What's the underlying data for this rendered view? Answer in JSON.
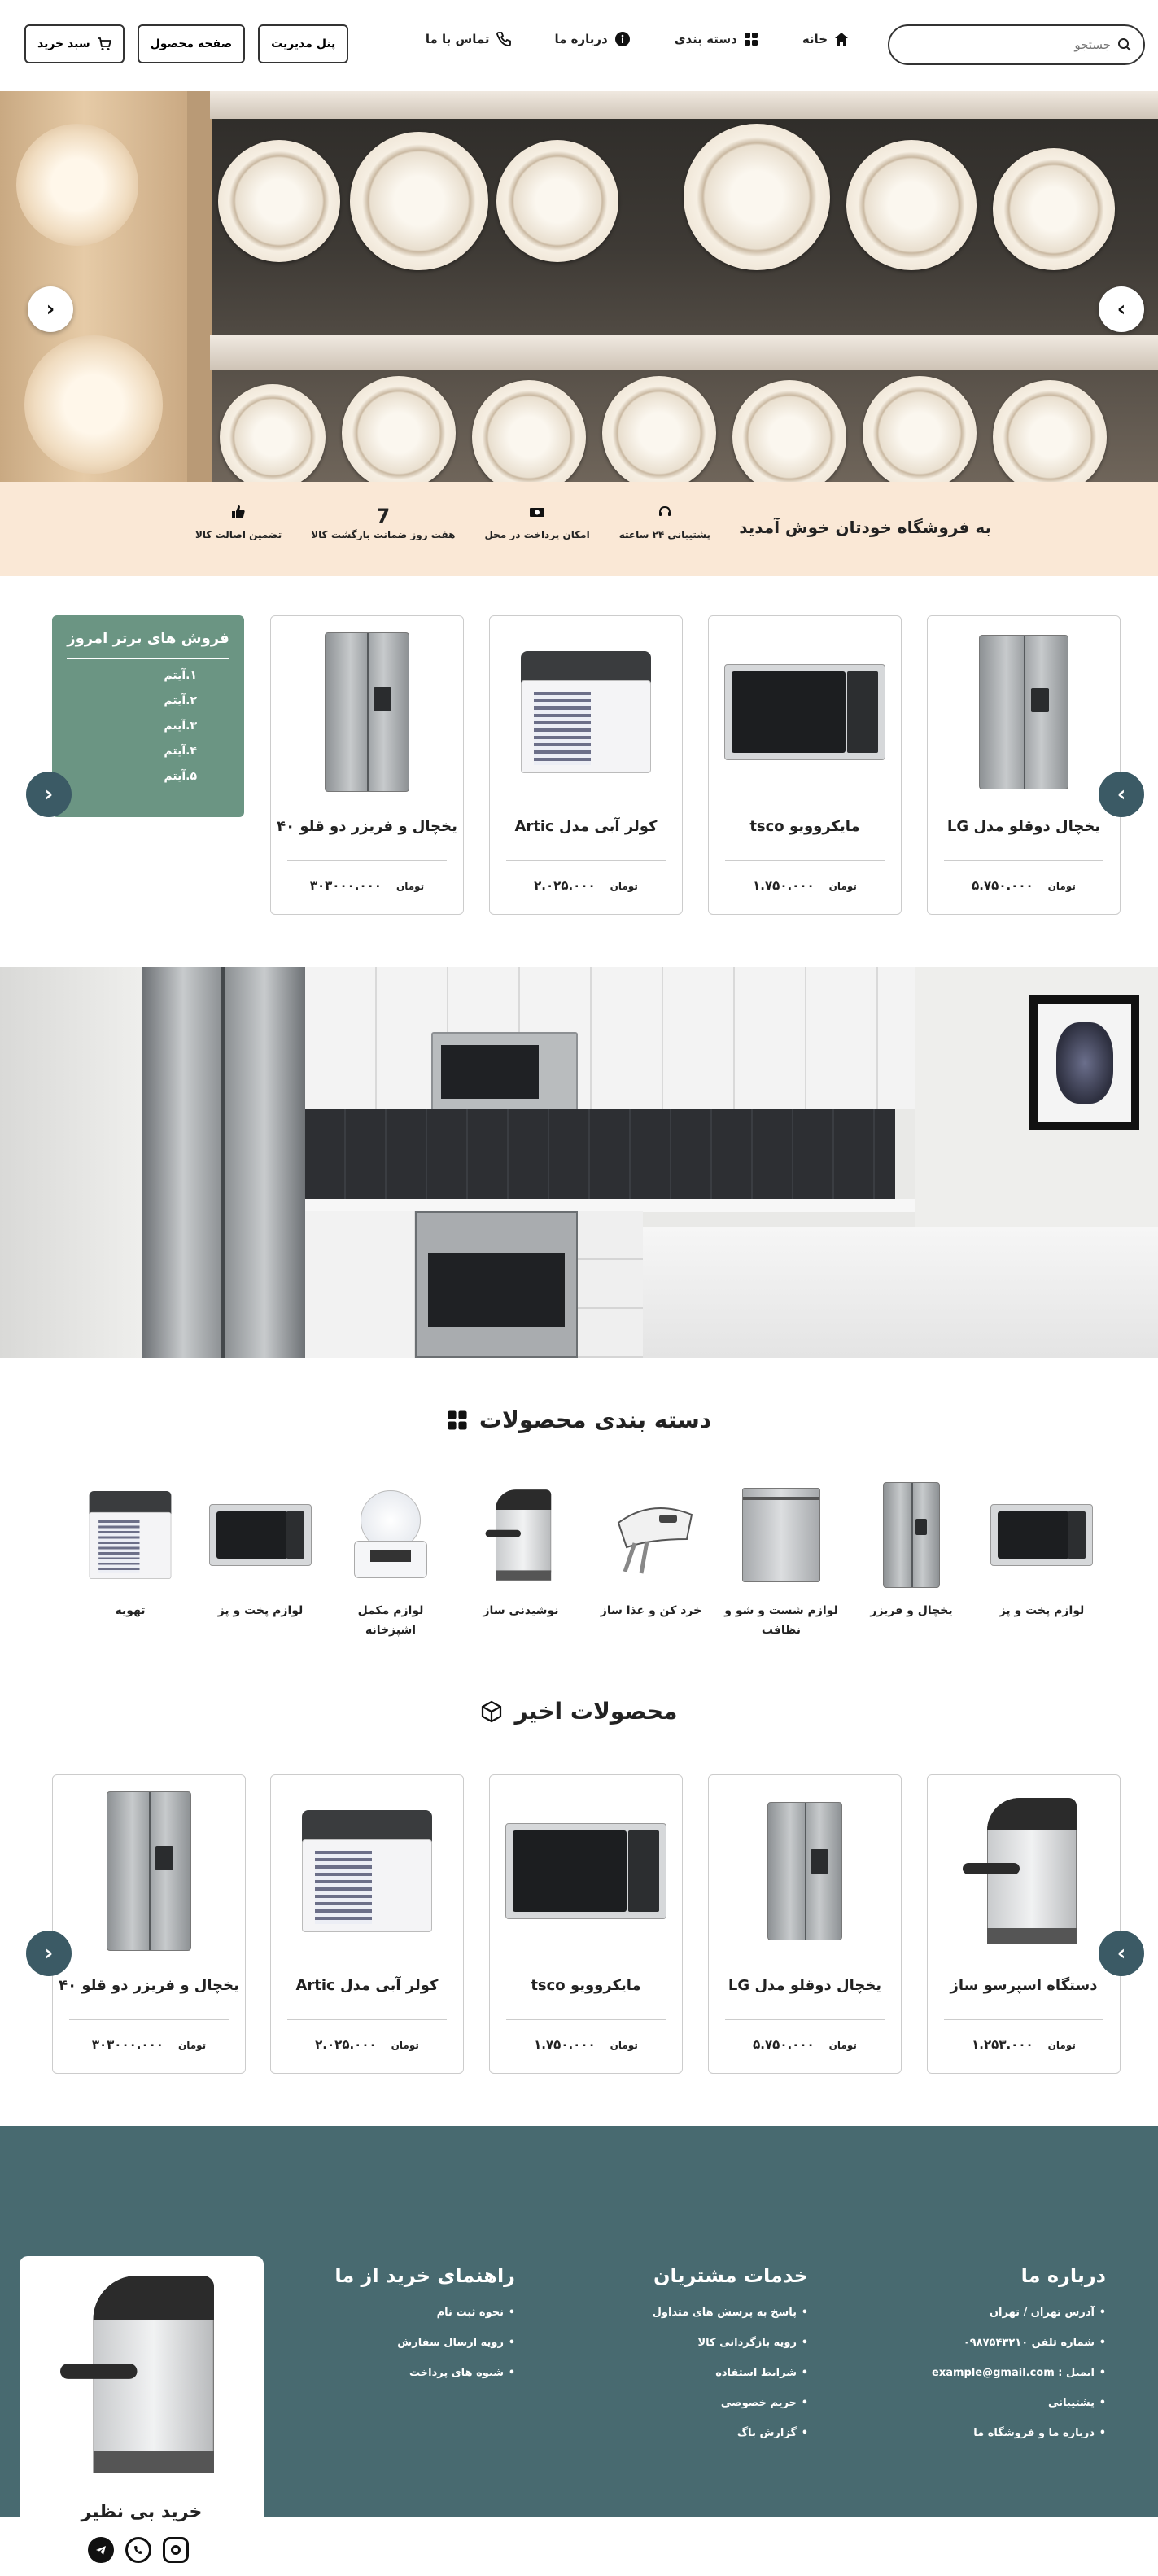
{
  "header": {
    "search_placeholder": "جستجو",
    "nav": [
      {
        "label": "خانه",
        "icon": "home-icon"
      },
      {
        "label": "دسته بندی",
        "icon": "grid-icon"
      },
      {
        "label": "درباره ما",
        "icon": "info-icon"
      },
      {
        "label": "تماس با ما",
        "icon": "phone-icon"
      }
    ],
    "buttons": {
      "admin": "پنل مدیریت",
      "product": "صفحه محصول",
      "cart": "سبد خرید"
    }
  },
  "welcome": {
    "title": "به فروشگاه خودتان خوش آمدید",
    "features": [
      {
        "label": "پشتیبانی ۲۴ ساعته",
        "icon": "headset-icon"
      },
      {
        "label": "امکان پرداخت در محل",
        "icon": "cash-icon"
      },
      {
        "label": "هفت روز ضمانت بازگشت کالا",
        "icon": "seven-icon",
        "glyph": "7"
      },
      {
        "label": "تضمین اصالت کالا",
        "icon": "thumbs-up-icon"
      }
    ]
  },
  "best_sellers": {
    "title": "فروش های برتر امروز",
    "items": [
      "۱.آیتم",
      "۲.آیتم",
      "۳.آیتم",
      "۴.آیتم",
      "۵.آیتم"
    ]
  },
  "top_products": [
    {
      "name": "یخچال دوقلو مدل LG",
      "price": "۵.۷۵۰.۰۰۰",
      "currency": "تومان",
      "kind": "fridge"
    },
    {
      "name": "مایکروویو tsco",
      "price": "۱.۷۵۰.۰۰۰",
      "currency": "تومان",
      "kind": "micro"
    },
    {
      "name": "کولر آبی مدل Artic",
      "price": "۲.۰۲۵.۰۰۰",
      "currency": "تومان",
      "kind": "cooler"
    },
    {
      "name": "یخچال و فریزر دو قلو ۴۰",
      "price": "۳۰۳۰۰۰.۰۰۰",
      "currency": "تومان",
      "kind": "fridge"
    }
  ],
  "categories_section": {
    "title": "دسته بندی محصولات",
    "items": [
      {
        "label": "لوازم پخت و پز",
        "kind": "micro"
      },
      {
        "label": "یخچال و فریزر",
        "kind": "fridge"
      },
      {
        "label": "لوازم شست و شو و نظافت",
        "kind": "dishwasher"
      },
      {
        "label": "خرد کن و غذا ساز",
        "kind": "mixer"
      },
      {
        "label": "نوشیدنی ساز",
        "kind": "espresso"
      },
      {
        "label": "لوازم مکمل اشپزخانه",
        "kind": "scale"
      },
      {
        "label": "لوازم پخت و پز",
        "kind": "micro"
      },
      {
        "label": "تهویه",
        "kind": "cooler"
      }
    ]
  },
  "recent_section": {
    "title": "محصولات اخیر",
    "items": [
      {
        "name": "دستگاه اسپرسو ساز",
        "price": "۱.۲۵۳.۰۰۰",
        "currency": "تومان",
        "kind": "espresso"
      },
      {
        "name": "یخچال دوقلو مدل LG",
        "price": "۵.۷۵۰.۰۰۰",
        "currency": "تومان",
        "kind": "fridge"
      },
      {
        "name": "مایکروویو tsco",
        "price": "۱.۷۵۰.۰۰۰",
        "currency": "تومان",
        "kind": "micro"
      },
      {
        "name": "کولر آبی مدل Artic",
        "price": "۲.۰۲۵.۰۰۰",
        "currency": "تومان",
        "kind": "cooler"
      },
      {
        "name": "یخچال و فریزر دو قلو ۴۰",
        "price": "۳۰۳۰۰۰.۰۰۰",
        "currency": "تومان",
        "kind": "fridge"
      }
    ]
  },
  "footer": {
    "about": {
      "title": "درباره ما",
      "items": [
        "آدرس تهران / تهران",
        "شماره تلفن ۰۹۸۷۵۴۳۲۱۰",
        "ایمیل : example@gmail.com",
        "پشتیبانی",
        "درباره ما و فروشگاه ما"
      ]
    },
    "services": {
      "title": "خدمات مشتریان",
      "items": [
        "پاسخ به پرسش های متداول",
        "رویه بازگردانی کالا",
        "شرایط استفاده",
        "حریم خصوصی",
        "گزارش باگ"
      ]
    },
    "guide": {
      "title": "راهنمای خرید از ما",
      "items": [
        "نحوه ثبت نام",
        "رویه ارسال سفارش",
        "شیوه های پرداخت"
      ]
    },
    "promo_title": "خرید بی نظیر",
    "social": [
      "telegram-icon",
      "whatsapp-icon",
      "instagram-icon"
    ]
  },
  "colors": {
    "welcome_bg": "#fae8d6",
    "best_seller_bg": "#6b9583",
    "footer_bg": "#486a70",
    "arrow_bg": "#3b5a65"
  }
}
